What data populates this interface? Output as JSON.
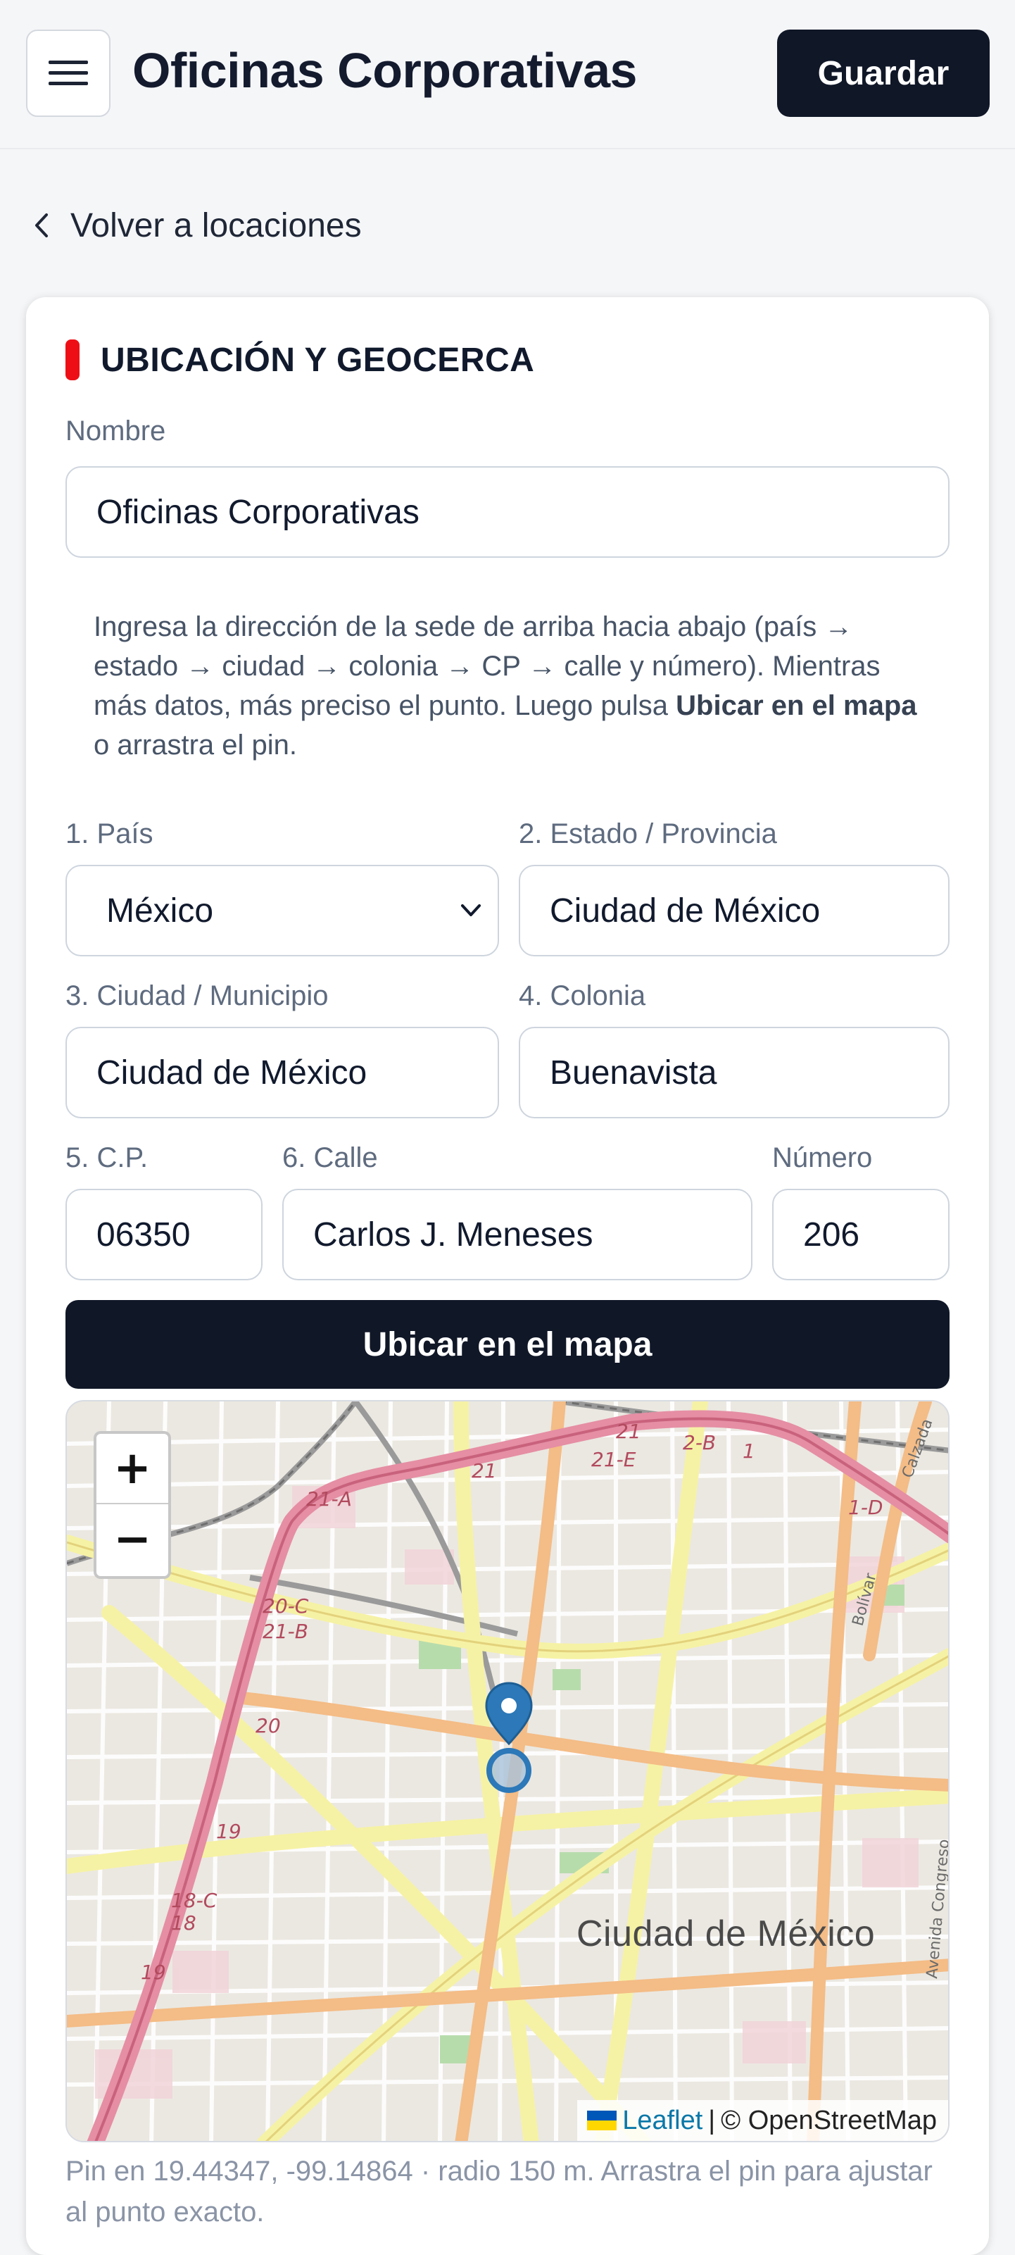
{
  "header": {
    "title": "Oficinas Corporativas",
    "save_label": "Guardar",
    "menu_icon": "hamburger-menu-icon"
  },
  "back_link": {
    "label": "Volver a locaciones",
    "icon": "chevron-left-icon"
  },
  "section": {
    "title": "UBICACIÓN Y GEOCERCA",
    "accent_color": "#ee0f16"
  },
  "form": {
    "name_label": "Nombre",
    "name_value": "Oficinas Corporativas",
    "helper_prefix": "Ingresa la dirección de la sede de arriba hacia abajo (país → estado → ciudad → colonia → CP → calle y número). Mientras más datos, más preciso el punto. Luego pulsa ",
    "helper_bold": "Ubicar en el mapa",
    "helper_suffix": " o arrastra el pin.",
    "country_label": "1. País",
    "country_value": "México",
    "state_label": "2. Estado / Provincia",
    "state_value": "Ciudad de México",
    "city_label": "3. Ciudad / Municipio",
    "city_value": "Ciudad de México",
    "colony_label": "4. Colonia",
    "colony_value": "Buenavista",
    "zip_label": "5. C.P.",
    "zip_value": "06350",
    "street_label": "6. Calle",
    "street_value": "Carlos J. Meneses",
    "number_label": "Número",
    "number_value": "206",
    "locate_label": "Ubicar en el mapa"
  },
  "map": {
    "zoom_in": "+",
    "zoom_out": "−",
    "city_name": "Ciudad de México",
    "road_labels": [
      "21",
      "21-E",
      "2-B",
      "1",
      "21-A",
      "21",
      "20-C",
      "21-B",
      "20",
      "19",
      "18-C",
      "18",
      "19",
      "1-D",
      "Bolívar",
      "Calzada",
      "Avenida Congreso"
    ],
    "attribution_link": "Leaflet",
    "attribution_sep": " | ",
    "attribution_text": "© OpenStreetMap",
    "marker_color": "#2c78b8",
    "caption": "Pin en 19.44347, -99.14864 · radio 150 m. Arrastra el pin para ajustar al punto exacto."
  },
  "colors": {
    "primary": "#101727",
    "background": "#f5f6f8",
    "muted_text": "#5e6b7f"
  }
}
